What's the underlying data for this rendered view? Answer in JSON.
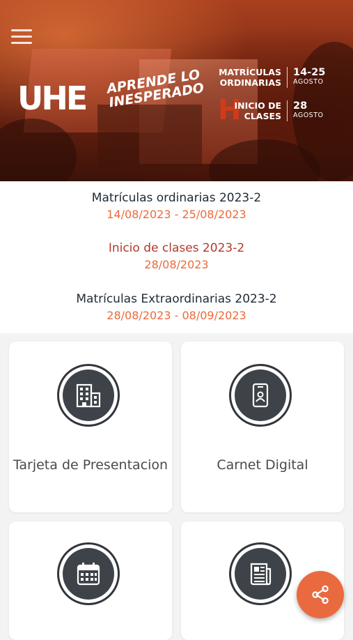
{
  "banner": {
    "logo": "UHE",
    "tagline_line1": "APRENDE LO",
    "tagline_line2": "INESPERADO",
    "promo": [
      {
        "label_line1": "MATRÍCULAS",
        "label_line2": "ORDINARIAS",
        "number": "14-25",
        "month": "AGOSTO"
      },
      {
        "label_line1": "INICIO DE",
        "label_line2": "CLASES",
        "number": "28",
        "month": "AGOSTO"
      }
    ]
  },
  "events": [
    {
      "title": "Matrículas ordinarias 2023-2",
      "range": "14/08/2023 - 25/08/2023"
    },
    {
      "title": "Inicio de clases 2023-2",
      "range": "28/08/2023"
    },
    {
      "title": "Matrículas Extraordinarias 2023-2",
      "range": "28/08/2023 - 08/09/2023"
    }
  ],
  "cards": [
    {
      "label": "Tarjeta de Presentacion",
      "icon": "building-icon"
    },
    {
      "label": "Carnet Digital",
      "icon": "id-card-icon"
    },
    {
      "label": "",
      "icon": "calendar-icon"
    },
    {
      "label": "",
      "icon": "newspaper-icon"
    }
  ],
  "fab": {
    "icon": "share-icon"
  },
  "colors": {
    "accent": "#ea6a3f",
    "date_text": "#ec6a3a",
    "title_dark": "#1f2a34",
    "title_red": "#b03a2e",
    "icon_bg": "#3e4349"
  }
}
